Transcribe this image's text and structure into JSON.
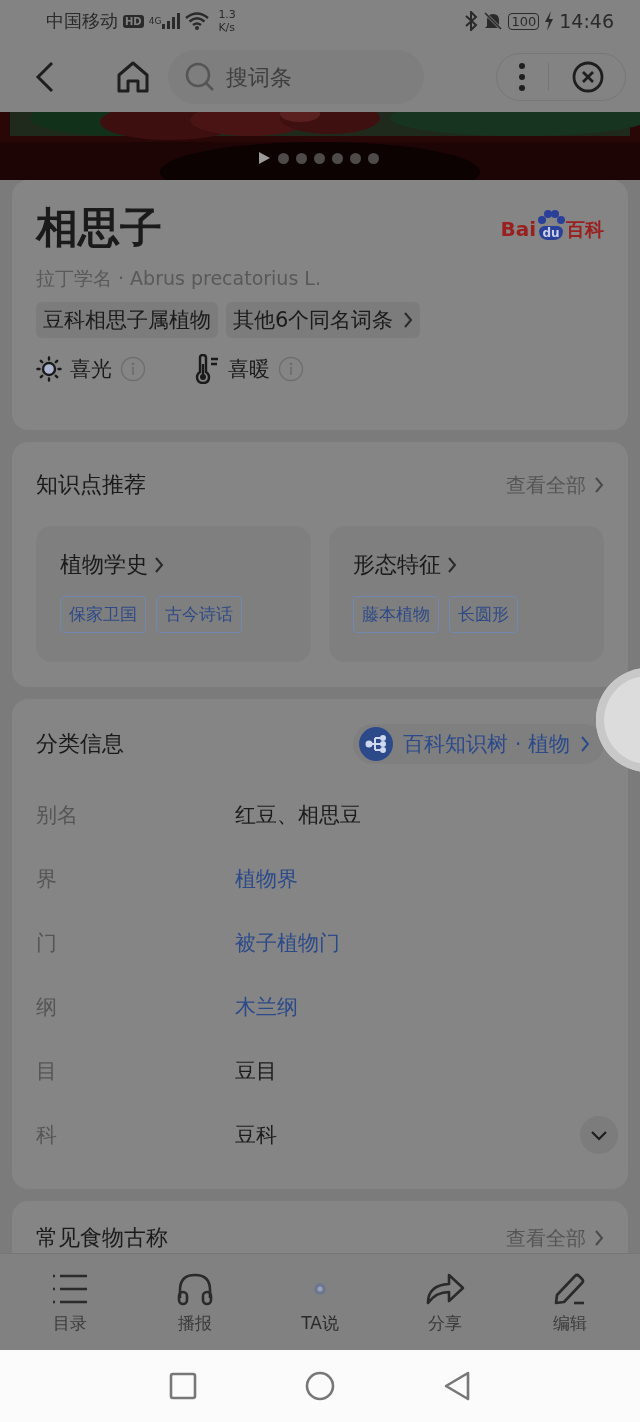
{
  "status_bar": {
    "carrier": "中国移动",
    "hd": "HD",
    "network": "4G",
    "speed_value": "1.3",
    "speed_unit": "K/s",
    "battery": "100",
    "time": "14:46"
  },
  "top_bar": {
    "search": {
      "placeholder": "搜词条"
    }
  },
  "carousel": {
    "kind": "picture",
    "dots": [
      {
        "selected": true
      },
      {
        "selected": false
      },
      {
        "selected": false
      },
      {
        "selected": false
      },
      {
        "selected": false
      },
      {
        "selected": false
      },
      {
        "selected": false
      }
    ]
  },
  "header": {
    "title": "相思子",
    "logo": {
      "left": "Bai",
      "paw": "du",
      "right": "百科"
    },
    "latin": "拉丁学名 · Abrus precatorius L.",
    "tags": [
      {
        "label": "豆科相思子属植物",
        "link": false
      },
      {
        "label": "其他6个同名词条",
        "link": true
      }
    ],
    "traits": [
      {
        "label": "喜光",
        "kind": "sun"
      },
      {
        "label": "喜暖",
        "kind": "thermometer"
      }
    ]
  },
  "knowledge": {
    "title": "知识点推荐",
    "more": "查看全部",
    "cards": [
      {
        "title": "植物学史",
        "tags": [
          "保家卫国",
          "古今诗话"
        ]
      },
      {
        "title": "形态特征",
        "tags": [
          "藤本植物",
          "长圆形"
        ]
      }
    ]
  },
  "classification": {
    "title": "分类信息",
    "tree_link": "百科知识树 · 植物",
    "expanded": false,
    "rows": [
      {
        "label": "别名",
        "value": "红豆、相思豆",
        "link": false
      },
      {
        "label": "界",
        "value": "植物界",
        "link": true
      },
      {
        "label": "门",
        "value": "被子植物门",
        "link": true
      },
      {
        "label": "纲",
        "value": "木兰纲",
        "link": true
      },
      {
        "label": "目",
        "value": "豆目",
        "link": false
      },
      {
        "label": "科",
        "value": "豆科",
        "link": false
      }
    ]
  },
  "food_names": {
    "title": "常见食物古称",
    "more": "查看全部"
  },
  "toolbar": [
    {
      "label": "目录",
      "kind": "list"
    },
    {
      "label": "播报",
      "kind": "headphones"
    },
    {
      "label": "TA说",
      "kind": "dot"
    },
    {
      "label": "分享",
      "kind": "share"
    },
    {
      "label": "编辑",
      "kind": "edit"
    }
  ]
}
